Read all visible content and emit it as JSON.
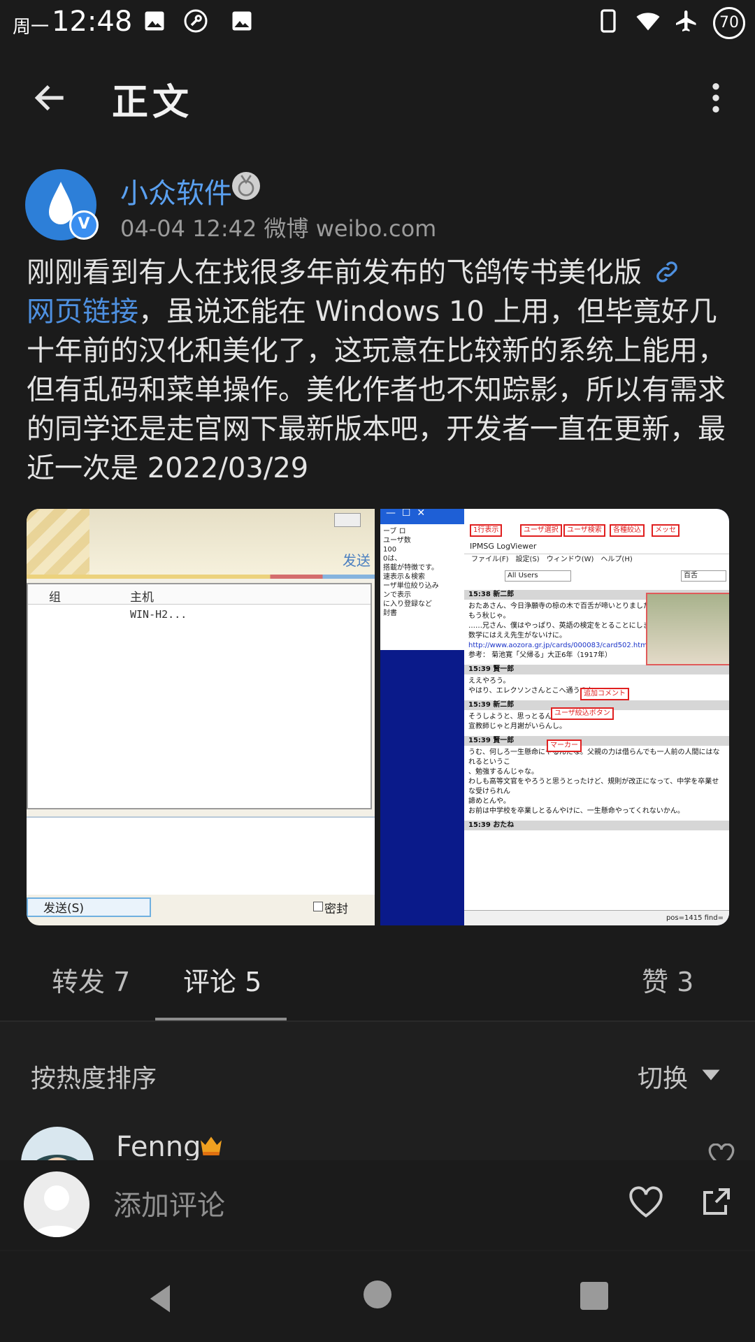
{
  "status_bar": {
    "day": "周一",
    "time": "12:48",
    "battery": "70",
    "icons": [
      "image-icon",
      "wrench-icon",
      "image-icon",
      "phone-icon",
      "wifi-icon",
      "airplane-icon"
    ]
  },
  "topbar": {
    "title": "正文",
    "back_icon": "arrow-left-icon",
    "more_icon": "more-vertical-icon"
  },
  "post": {
    "author": "小众软件",
    "verified_mark": "V",
    "meta": "04-04 12:42  微博 weibo.com",
    "text_line1": "刚刚看到有人在找很多年前发布的飞鸽传书美化版",
    "link_text": "网页链接",
    "text_rest": "，虽说还能在 Windows 10 上用，但毕竟好几十年前的汉化和美化了，这玩意在比较新的系统上能用，但有乱码和菜单操作。美化作者也不知踪影，所以有需求的同学还是走官网下最新版本吧，开发者一直在更新，最近一次是 2022/03/29"
  },
  "images": {
    "left": {
      "col_group": "组",
      "col_host": "主机",
      "host_value": "WIN-H2...",
      "send_header": "发送",
      "send_button": "发送(S)",
      "seal_checkbox": "密封"
    },
    "right": {
      "window_title": "IPMSG LogViewer",
      "menu": [
        "ファイル(F)",
        "設定(S)",
        "ウィンドウ(W)",
        "ヘルプ(H)"
      ],
      "user_select": "All Users",
      "search_value": "百舌",
      "labels": [
        "1行表示",
        "ユーザ選択",
        "ユーザ検索",
        "各種絞込",
        "メッセ",
        "追加コメント",
        "ユーザ絞込ボタン",
        "マーカー"
      ],
      "side_lines": [
        "ーブ ロ",
        "ユーザ数",
        "100",
        "0は、",
        "搭載が特徴です。",
        "速表示＆検索",
        "ーザ単位絞り込み",
        "ンで表示",
        "に入り登録など",
        "封書"
      ],
      "log": [
        {
          "time": "15:38",
          "user": "新二郎"
        },
        {
          "text": "おたあさん、今日浄願寺の椋の木で百舌が啼いとりましたよ。"
        },
        {
          "text": "もう秋じゃ。"
        },
        {
          "text": "……兄さん、僕はやっぱり、英語の検定をとることにしました。"
        },
        {
          "text": "数学にはええ先生がないけに。"
        },
        {
          "url": "http://www.aozora.gr.jp/cards/000083/card502.html"
        },
        {
          "text": "参考： 菊池寛「父帰る」大正6年（1917年）"
        },
        {
          "time": "15:39",
          "user": "賢一郎"
        },
        {
          "text": "ええやろう。"
        },
        {
          "text": "やはり、エレクソンさんとこへ通うのか"
        },
        {
          "time": "15:39",
          "user": "新二郎"
        },
        {
          "text": "そうしようと、思っとるんです。"
        },
        {
          "text": "宣教師じゃと月謝がいらんし。"
        },
        {
          "time": "15:39",
          "user": "賢一郎"
        },
        {
          "text": "うむ、何しろ一生懸命にやるんだな。父親の力は借らんでも一人前の人間にはなれるというこ"
        },
        {
          "text": "、勉強するんじゃな。"
        },
        {
          "text": "わしも高等文官をやろうと思うとったけど、規則が改正になって、中学を卒業せな受けられん"
        },
        {
          "text": "諦めとんや。"
        },
        {
          "text": "お前は中学校を卒業しとるんやけに、一生懸命やってくれないかん。"
        },
        {
          "time": "15:39",
          "user": "おたね"
        }
      ],
      "statusbar": "pos=1415 find="
    }
  },
  "tabs": [
    {
      "label": "转发 7"
    },
    {
      "label": "评论 5"
    },
    {
      "label": "赞 3"
    }
  ],
  "comments": {
    "sort_label": "按热度排序",
    "switch_label": "切换",
    "first_user": "Fenng"
  },
  "composer": {
    "placeholder": "添加评论"
  },
  "colors": {
    "link": "#4e90e0",
    "background": "#1b1b1b",
    "author": "#5aa0f0"
  }
}
